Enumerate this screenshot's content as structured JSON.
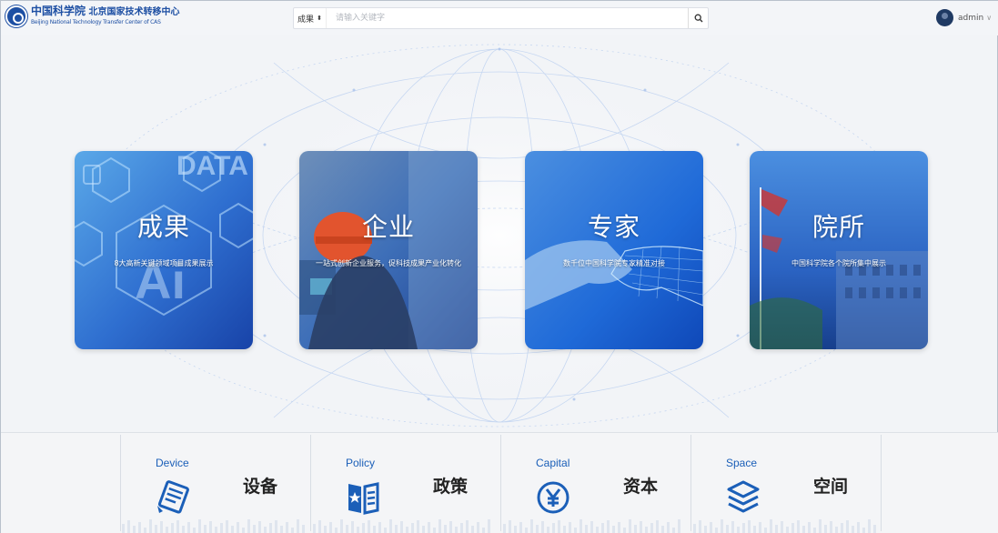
{
  "header": {
    "logo_cn_main": "中国科学院",
    "logo_cn_sub": "北京国家技术转移中心",
    "logo_en": "Beijing National Technology Transfer Center of CAS",
    "search": {
      "category": "成果",
      "placeholder": "请输入关键字",
      "button_icon": "search-icon"
    },
    "user": {
      "name": "admin",
      "chevron_icon": "chevron-down-icon"
    }
  },
  "cards": [
    {
      "title": "成果",
      "subtitle": "8大高新关键领域项目成果展示"
    },
    {
      "title": "企业",
      "subtitle": "一站式创新企业服务，促科技成果产业化转化"
    },
    {
      "title": "专家",
      "subtitle": "数千位中国科学院专家精准对接"
    },
    {
      "title": "院所",
      "subtitle": "中国科学院各个院所集中展示"
    }
  ],
  "bottom": [
    {
      "en": "Device",
      "cn": "设备",
      "icon": "device-icon"
    },
    {
      "en": "Policy",
      "cn": "政策",
      "icon": "policy-book-icon"
    },
    {
      "en": "Capital",
      "cn": "资本",
      "icon": "yuan-icon"
    },
    {
      "en": "Space",
      "cn": "空间",
      "icon": "layers-icon"
    }
  ],
  "colors": {
    "brand": "#1b5fb8",
    "background": "#f2f4f7"
  }
}
